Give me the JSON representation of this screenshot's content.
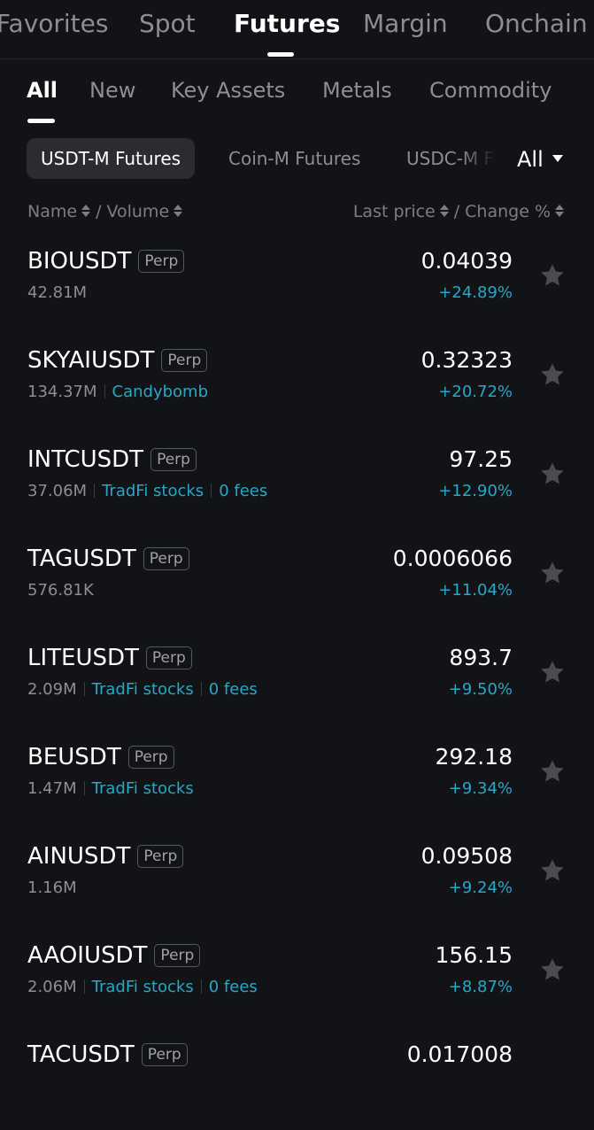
{
  "top_tabs": [
    "Favorites",
    "Spot",
    "Futures",
    "Margin",
    "Onchain"
  ],
  "sub_tabs": [
    "All",
    "New",
    "Key Assets",
    "Metals",
    "Commodity"
  ],
  "market_chips": [
    "USDT-M Futures",
    "Coin-M Futures",
    "USDC-M F"
  ],
  "filter": {
    "label": "All"
  },
  "columns": {
    "name": "Name",
    "volume": "Volume",
    "last_price": "Last price",
    "change": "Change %",
    "separator": "/"
  },
  "badge_label": "Perp",
  "colors": {
    "background": "#121316",
    "positive_change": "#26a8c7",
    "tag_link": "#26a8c7",
    "star": "#4a4c52"
  },
  "rows": [
    {
      "symbol": "BIOUSDT",
      "volume": "42.81M",
      "tags": [],
      "price": "0.04039",
      "change": "+24.89%"
    },
    {
      "symbol": "SKYAIUSDT",
      "volume": "134.37M",
      "tags": [
        "Candybomb"
      ],
      "price": "0.32323",
      "change": "+20.72%"
    },
    {
      "symbol": "INTCUSDT",
      "volume": "37.06M",
      "tags": [
        "TradFi stocks",
        "0 fees"
      ],
      "price": "97.25",
      "change": "+12.90%"
    },
    {
      "symbol": "TAGUSDT",
      "volume": "576.81K",
      "tags": [],
      "price": "0.0006066",
      "change": "+11.04%"
    },
    {
      "symbol": "LITEUSDT",
      "volume": "2.09M",
      "tags": [
        "TradFi stocks",
        "0 fees"
      ],
      "price": "893.7",
      "change": "+9.50%"
    },
    {
      "symbol": "BEUSDT",
      "volume": "1.47M",
      "tags": [
        "TradFi stocks"
      ],
      "price": "292.18",
      "change": "+9.34%"
    },
    {
      "symbol": "AINUSDT",
      "volume": "1.16M",
      "tags": [],
      "price": "0.09508",
      "change": "+9.24%"
    },
    {
      "symbol": "AAOIUSDT",
      "volume": "2.06M",
      "tags": [
        "TradFi stocks",
        "0 fees"
      ],
      "price": "156.15",
      "change": "+8.87%"
    },
    {
      "symbol": "TACUSDT",
      "volume": "",
      "tags": [],
      "price": "0.017008",
      "change": ""
    }
  ]
}
